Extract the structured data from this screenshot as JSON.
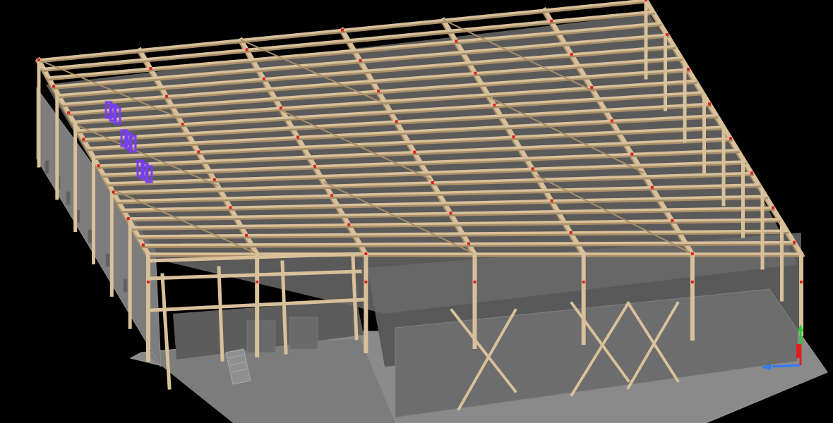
{
  "viewport": {
    "background_color": "#000000",
    "view": "isometric",
    "model": "steel-frame-building"
  },
  "colors": {
    "beam": "#d8c09a",
    "beam_shadow": "#a88f68",
    "floor": "#6a6a6a",
    "wall": "#7d7d7d",
    "wall_dark": "#5a5a5a",
    "slab": "#8a8a8a",
    "connection": "#e02020",
    "selected": "#7a3cff",
    "axis_x": "#2e7bff",
    "axis_y": "#22cc33",
    "axis_z": "#e02020"
  },
  "icons": {
    "axis_gizmo": "axis-triad-icon"
  }
}
